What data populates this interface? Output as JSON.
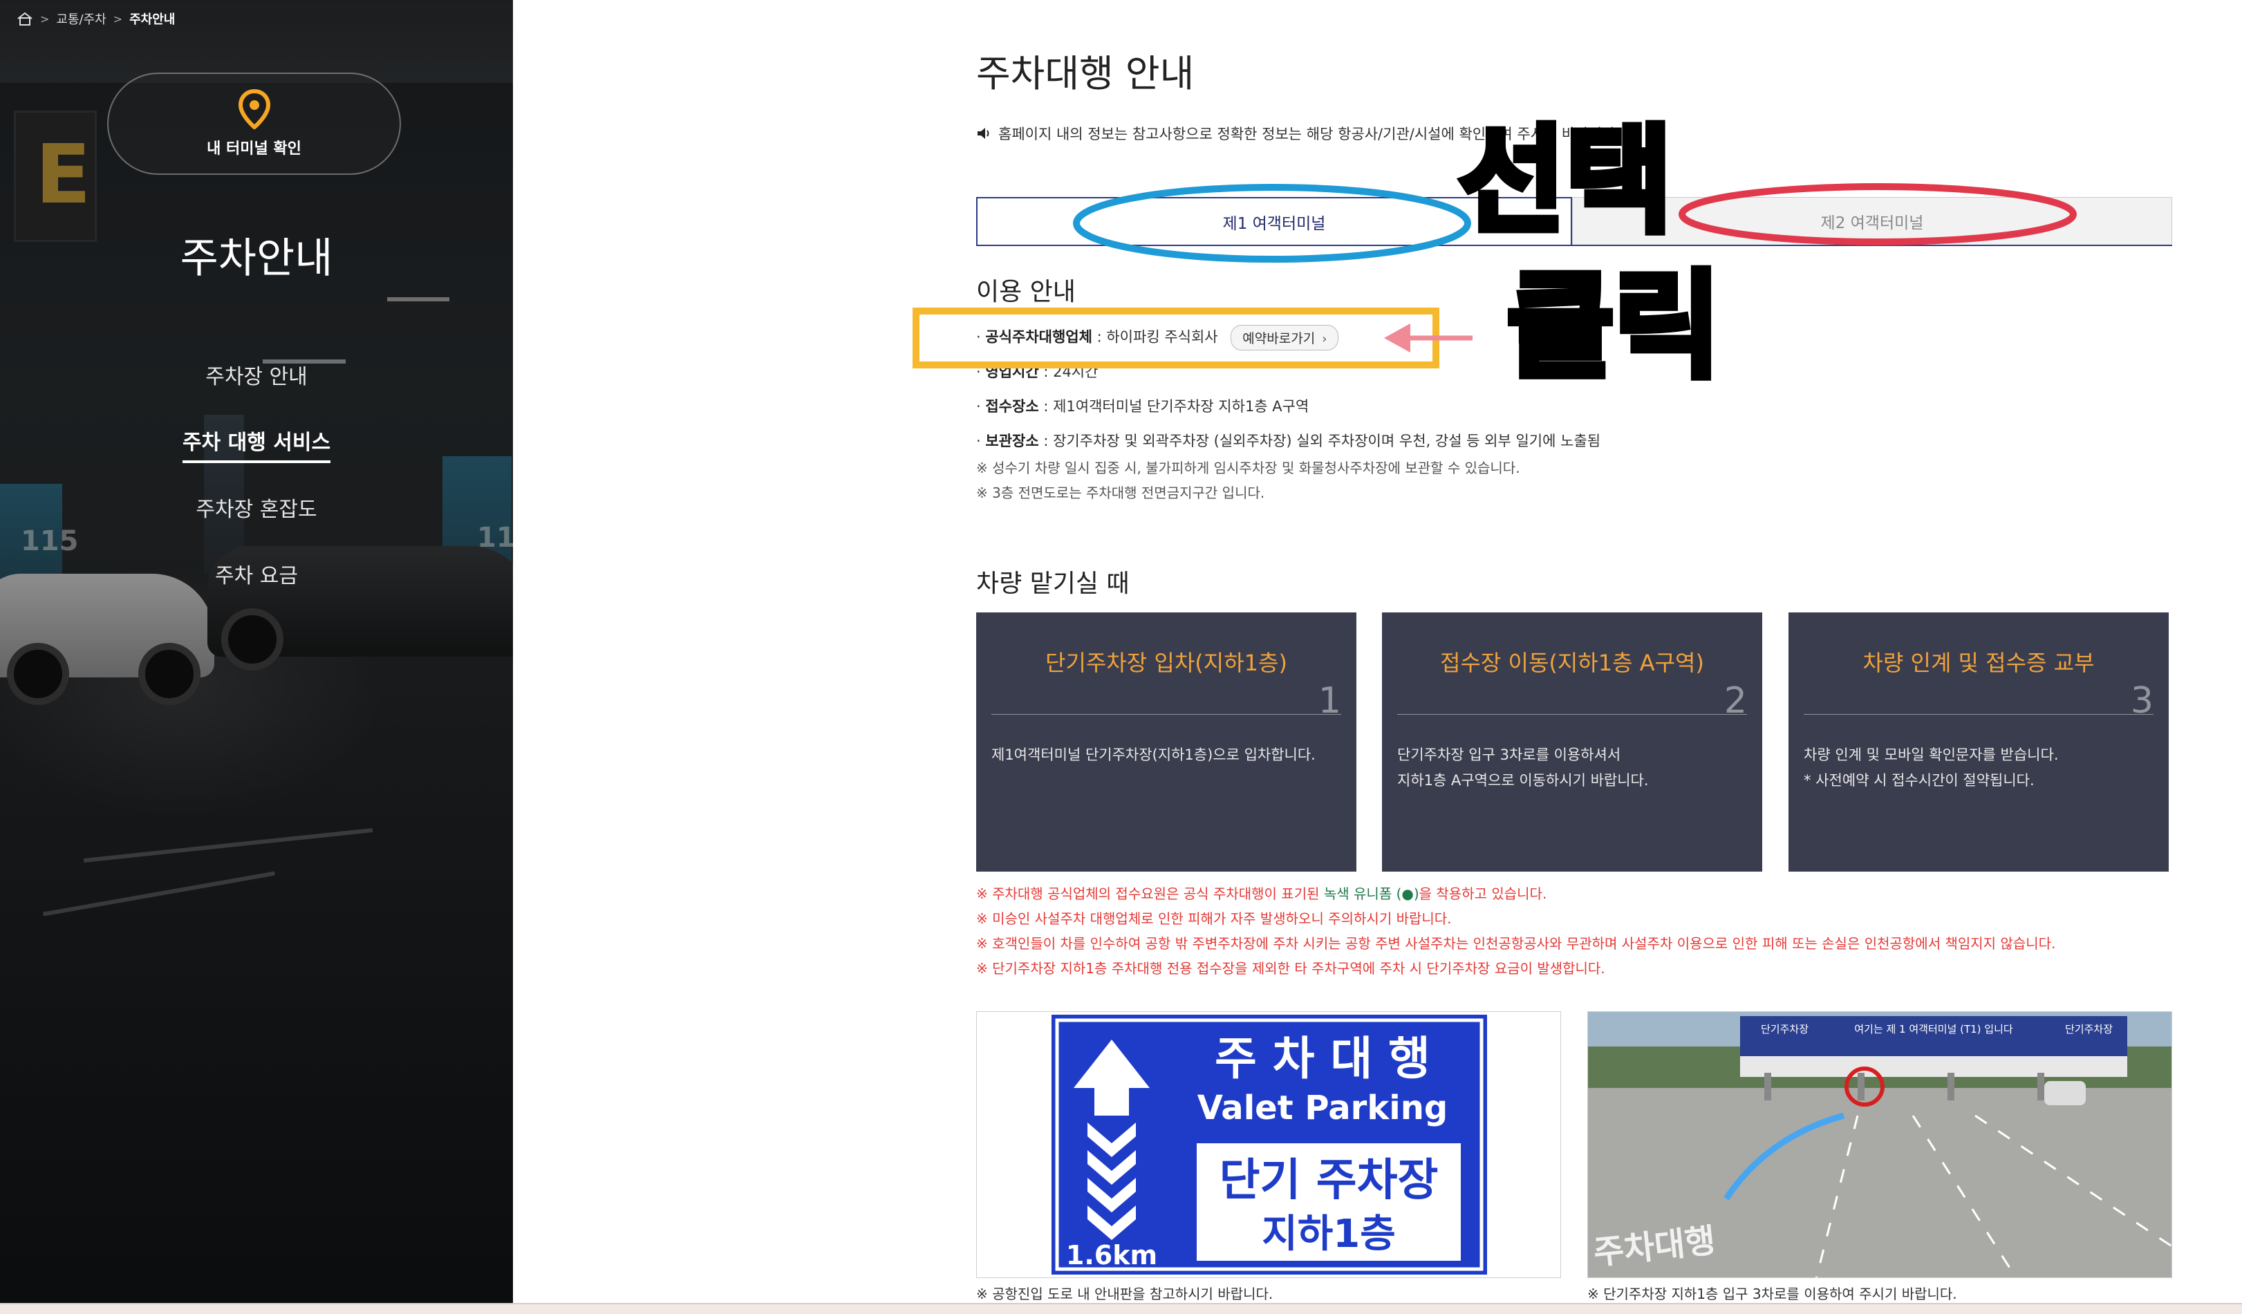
{
  "breadcrumb": {
    "section": "교통/주차",
    "current": "주차안내"
  },
  "sidebar": {
    "terminal_check_label": "내 터미널 확인",
    "title": "주차안내",
    "nav": [
      "주차장 안내",
      "주차 대행 서비스",
      "주차장 혼잡도",
      "주차 요금"
    ],
    "active_index": 1
  },
  "page": {
    "title": "주차대행 안내",
    "notice": "홈페이지 내의 정보는 참고사항으로 정확한 정보는 해당 항공사/기관/시설에 확인하여 주시기 바랍니다."
  },
  "tabs": {
    "t1": "제1 여객터미널",
    "t2": "제2 여객터미널",
    "selected": "t1"
  },
  "usage": {
    "title": "이용 안내",
    "company_label": "공식주차대행업체",
    "company_value": "하이파킹 주식회사",
    "reserve_button": "예약바로가기",
    "hours_label": "영업시간",
    "hours_value": "24시간",
    "reception_label": "접수장소",
    "reception_value": "제1여객터미널 단기주차장 지하1층 A구역",
    "storage_label": "보관장소",
    "storage_value": "장기주차장 및 외곽주차장 (실외주차장) 실외 주차장이며 우천, 강설 등 외부 일기에 노출됨",
    "note1": "※ 성수기 차량 일시 집중 시, 불가피하게 임시주차장 및 화물청사주차장에 보관할 수 있습니다.",
    "note2": "※ 3층 전면도로는 주차대행 전면금지구간 입니다."
  },
  "dropoff": {
    "title": "차량 맡기실 때",
    "steps": [
      {
        "title": "단기주차장 입차(지하1층)",
        "num": "1",
        "desc1": "제1여객터미널 단기주차장(지하1층)으로 입차합니다.",
        "desc2": ""
      },
      {
        "title": "접수장 이동(지하1층 A구역)",
        "num": "2",
        "desc1": "단기주차장 입구 3차로를 이용하셔서",
        "desc2": "지하1층 A구역으로 이동하시기 바랍니다."
      },
      {
        "title": "차량 인계 및 접수증 교부",
        "num": "3",
        "desc1": "차량 인계 및 모바일 확인문자를 받습니다.",
        "desc2": "* 사전예약 시 접수시간이 절약됩니다."
      }
    ]
  },
  "warnings": {
    "w1_pre": "※ 주차대행 공식업체의 접수요원은 공식 주차대행이 표기된 ",
    "w1_green": "녹색 유니폼 (●)",
    "w1_post": "을 착용하고 있습니다.",
    "w2": "※ 미승인 사설주차 대행업체로 인한 피해가 자주 발생하오니 주의하시기 바랍니다.",
    "w3": "※ 호객인들이 차를 인수하여 공항 밖 주변주차장에 주차 시키는 공항 주변 사설주차는 인천공항공사와 무관하며 사설주차 이용으로 인한 피해 또는 손실은 인천공항에서 책임지지 않습니다.",
    "w4": "※ 단기주차장 지하1층 주차대행 전용 접수장을 제외한 타 주차구역에 주차 시 단기주차장 요금이 발생합니다."
  },
  "sign": {
    "line1": "주 차 대 행",
    "line2": "Valet Parking",
    "line3": "단기 주차장",
    "line4": "지하1층",
    "distance": "1.6km"
  },
  "photo": {
    "banner_left": "단기주차장",
    "banner_center": "여기는 제 1 여객터미널 (T1) 입니다",
    "banner_right": "단기주차장",
    "road_text": "주차대행"
  },
  "captions": {
    "sign": "※ 공항진입 도로 내 안내판을 참고하시기 바랍니다.",
    "photo": "※ 단기주차장 지하1층 입구 3차로를 이용하여 주시기 바랍니다."
  },
  "annotations": {
    "select": "선택",
    "click": "클릭"
  },
  "colors": {
    "accent_navy": "#2b3a8a",
    "step_card_bg": "#3a3d4e",
    "step_title": "#f0a23b",
    "warning_red": "#e53935",
    "sign_blue": "#1e3cc8",
    "highlight_blue": "#1e9ad6",
    "highlight_red": "#e0394b",
    "highlight_yellow": "#f5b82e"
  }
}
